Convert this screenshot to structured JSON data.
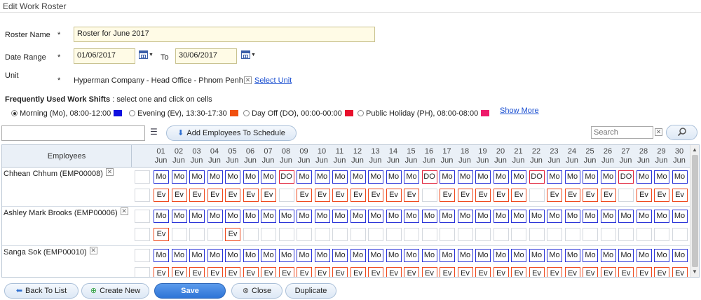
{
  "page": {
    "title": "Edit Work Roster"
  },
  "form": {
    "roster_name_label": "Roster Name",
    "roster_name_value": "Roster for June 2017",
    "date_range_label": "Date Range",
    "date_from": "01/06/2017",
    "to_label": "To",
    "date_to": "30/06/2017",
    "unit_label": "Unit",
    "unit_value": "Hyperman Company - Head Office - Phnom Penh",
    "select_unit_link": "Select Unit",
    "required_mark": "*"
  },
  "shifts": {
    "heading_bold": "Frequently Used Work Shifts",
    "heading_rest": " : select one and click on cells",
    "items": [
      {
        "label": "Morning (Mo), 08:00-12:00",
        "color": "#1010e0",
        "selected": true
      },
      {
        "label": "Evening (Ev), 13:30-17:30",
        "color": "#f05010",
        "selected": false
      },
      {
        "label": "Day Off (DO), 00:00-00:00",
        "color": "#e8102c",
        "selected": false
      },
      {
        "label": "Public Holiday (PH), 08:00-08:00",
        "color": "#ee1a6a",
        "selected": false
      }
    ],
    "show_more": "Show More"
  },
  "toolbar": {
    "add_employees": "Add Employees To Schedule",
    "search_placeholder": "Search"
  },
  "grid": {
    "employees_header": "Employees",
    "days": [
      "01",
      "02",
      "03",
      "04",
      "05",
      "06",
      "07",
      "08",
      "09",
      "10",
      "11",
      "12",
      "13",
      "14",
      "15",
      "16",
      "17",
      "18",
      "19",
      "20",
      "21",
      "22",
      "23",
      "24",
      "25",
      "26",
      "27",
      "28",
      "29",
      "30"
    ],
    "month": "Jun",
    "employees": [
      {
        "name": "Chhean Chhum (EMP00008)",
        "row1": [
          "Mo",
          "Mo",
          "Mo",
          "Mo",
          "Mo",
          "Mo",
          "Mo",
          "DO",
          "Mo",
          "Mo",
          "Mo",
          "Mo",
          "Mo",
          "Mo",
          "Mo",
          "DO",
          "Mo",
          "Mo",
          "Mo",
          "Mo",
          "Mo",
          "DO",
          "Mo",
          "Mo",
          "Mo",
          "Mo",
          "DO",
          "Mo",
          "Mo",
          "Mo"
        ],
        "row2": [
          "Ev",
          "Ev",
          "Ev",
          "Ev",
          "Ev",
          "Ev",
          "Ev",
          "",
          "Ev",
          "Ev",
          "Ev",
          "Ev",
          "Ev",
          "Ev",
          "Ev",
          "",
          "Ev",
          "Ev",
          "Ev",
          "Ev",
          "Ev",
          "",
          "Ev",
          "Ev",
          "Ev",
          "Ev",
          "",
          "Ev",
          "Ev",
          "Ev"
        ]
      },
      {
        "name": "Ashley Mark Brooks (EMP00006)",
        "row1": [
          "Mo",
          "Mo",
          "Mo",
          "Mo",
          "Mo",
          "Mo",
          "Mo",
          "Mo",
          "Mo",
          "Mo",
          "Mo",
          "Mo",
          "Mo",
          "Mo",
          "Mo",
          "Mo",
          "Mo",
          "Mo",
          "Mo",
          "Mo",
          "Mo",
          "Mo",
          "Mo",
          "Mo",
          "Mo",
          "Mo",
          "Mo",
          "Mo",
          "Mo",
          "Mo"
        ],
        "row2": [
          "Ev",
          "",
          "",
          "",
          "Ev",
          "",
          "",
          "",
          "",
          "",
          "",
          "",
          "",
          "",
          "",
          "",
          "",
          "",
          "",
          "",
          "",
          "",
          "",
          "",
          "",
          "",
          "",
          "",
          "",
          ""
        ]
      },
      {
        "name": "Sanga Sok (EMP00010)",
        "row1": [
          "Mo",
          "Mo",
          "Mo",
          "Mo",
          "Mo",
          "Mo",
          "Mo",
          "Mo",
          "Mo",
          "Mo",
          "Mo",
          "Mo",
          "Mo",
          "Mo",
          "Mo",
          "Mo",
          "Mo",
          "Mo",
          "Mo",
          "Mo",
          "Mo",
          "Mo",
          "Mo",
          "Mo",
          "Mo",
          "Mo",
          "Mo",
          "Mo",
          "Mo",
          "Mo"
        ],
        "row2": [
          "Ev",
          "Ev",
          "Ev",
          "Ev",
          "Ev",
          "Ev",
          "Ev",
          "Ev",
          "Ev",
          "Ev",
          "Ev",
          "Ev",
          "Ev",
          "Ev",
          "Ev",
          "Ev",
          "Ev",
          "Ev",
          "Ev",
          "Ev",
          "Ev",
          "Ev",
          "Ev",
          "Ev",
          "Ev",
          "Ev",
          "Ev",
          "Ev",
          "Ev",
          "Ev"
        ]
      }
    ]
  },
  "footer": {
    "back": "Back To List",
    "create_new": "Create New",
    "save": "Save",
    "close": "Close",
    "duplicate": "Duplicate"
  }
}
